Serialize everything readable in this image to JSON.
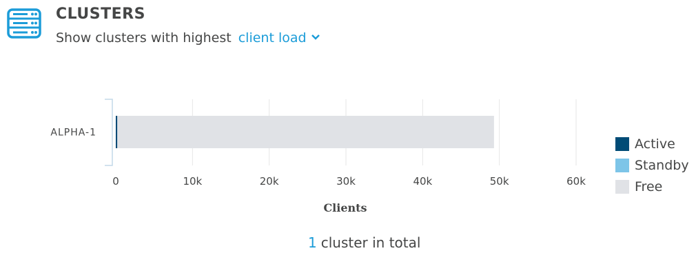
{
  "header": {
    "title": "CLUSTERS",
    "subtitle_prefix": "Show clusters with highest",
    "metric_selector": "client load",
    "icon": "server-rack-icon"
  },
  "chart_data": {
    "type": "bar",
    "orientation": "horizontal",
    "stacked": true,
    "categories": [
      "ALPHA-1"
    ],
    "series": [
      {
        "name": "Active",
        "color": "#004b76",
        "values": [
          200
        ]
      },
      {
        "name": "Standby",
        "color": "#7dc5e8",
        "values": [
          0
        ]
      },
      {
        "name": "Free",
        "color": "#e0e2e6",
        "values": [
          49100
        ]
      }
    ],
    "xlabel": "Clients",
    "ylabel": "",
    "xlim": [
      0,
      60000
    ],
    "ticks": [
      "0",
      "10k",
      "20k",
      "30k",
      "40k",
      "50k",
      "60k"
    ],
    "grid": true,
    "legend_position": "right"
  },
  "footer": {
    "count": "1",
    "label": "cluster in total"
  }
}
